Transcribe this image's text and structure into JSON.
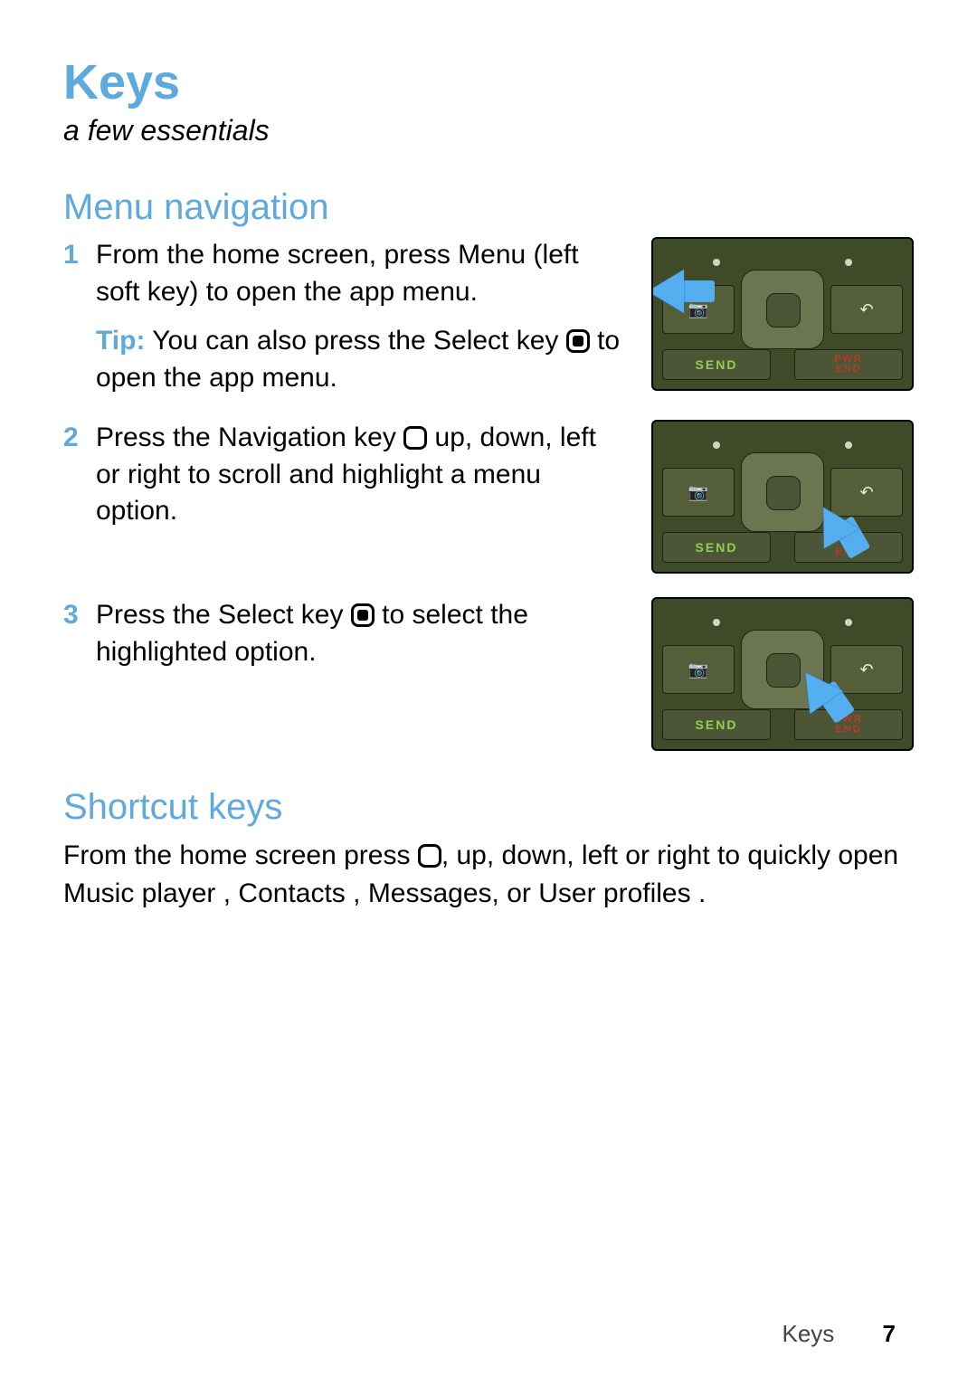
{
  "title": "Keys",
  "subtitle": "a few essentials",
  "sections": {
    "menu_nav": {
      "heading": "Menu navigation",
      "steps": [
        {
          "text_a": "From the home screen, press ",
          "bold": "Menu",
          "text_b": " (left soft key) to open the app menu.",
          "tip_label": "Tip:",
          "tip_a": " You can also press the Select key ",
          "tip_b": " to open the app menu."
        },
        {
          "text_a": "Press the Navigation key ",
          "text_b": " up, down, left or right to scroll and highlight a menu option."
        },
        {
          "text_a": "Press the Select key ",
          "text_b": " to select the highlighted option."
        }
      ]
    },
    "shortcut": {
      "heading": "Shortcut keys",
      "body_a": "From the home screen press ",
      "body_b": ", up, down, left or right to quickly open ",
      "app1": "Music player",
      "sep1": " , ",
      "app2": "Contacts",
      "sep2": " , ",
      "app3": "Messages",
      "sep3": ", or ",
      "app4": "User profiles",
      "tail": " ."
    }
  },
  "keypad": {
    "send": "SEND",
    "end_line1": "PWR",
    "end_line2": "END",
    "camera_icon": "📷",
    "back_icon": "↶"
  },
  "footer": {
    "section": "Keys",
    "page": "7"
  }
}
